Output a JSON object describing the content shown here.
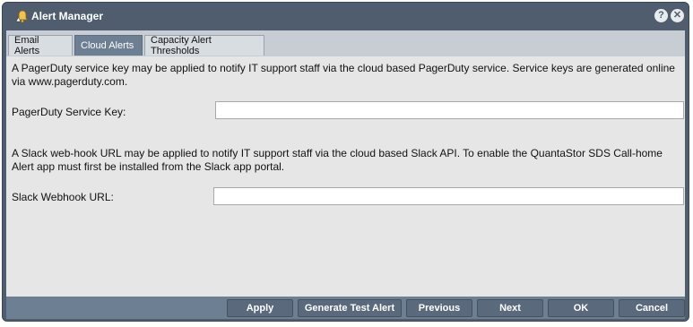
{
  "window": {
    "title": "Alert Manager",
    "icon": "bell-alert-icon",
    "help_label": "?",
    "close_label": "✕"
  },
  "tabs": [
    {
      "label": "Email Alerts",
      "active": false
    },
    {
      "label": "Cloud Alerts",
      "active": true
    },
    {
      "label": "Capacity Alert Thresholds",
      "active": false
    }
  ],
  "content": {
    "pagerduty_description": "A PagerDuty service key may be applied to notify IT support staff via the cloud based PagerDuty service. Service keys are generated online via www.pagerduty.com.",
    "pagerduty_label": "PagerDuty Service Key:",
    "pagerduty_value": "",
    "slack_description": "A Slack web-hook URL may be applied to notify IT support staff via the cloud based Slack API. To enable the QuantaStor SDS Call-home Alert app must first be installed from the Slack app portal.",
    "slack_label": "Slack Webhook URL:",
    "slack_value": ""
  },
  "buttons": {
    "apply": "Apply",
    "generate_test_alert": "Generate Test Alert",
    "previous": "Previous",
    "next": "Next",
    "ok": "OK",
    "cancel": "Cancel"
  },
  "colors": {
    "frame": "#4f5d6e",
    "active_tab": "#6c7f93",
    "content_bg": "#e6e6e6",
    "button_bg": "#5a6a7c"
  }
}
